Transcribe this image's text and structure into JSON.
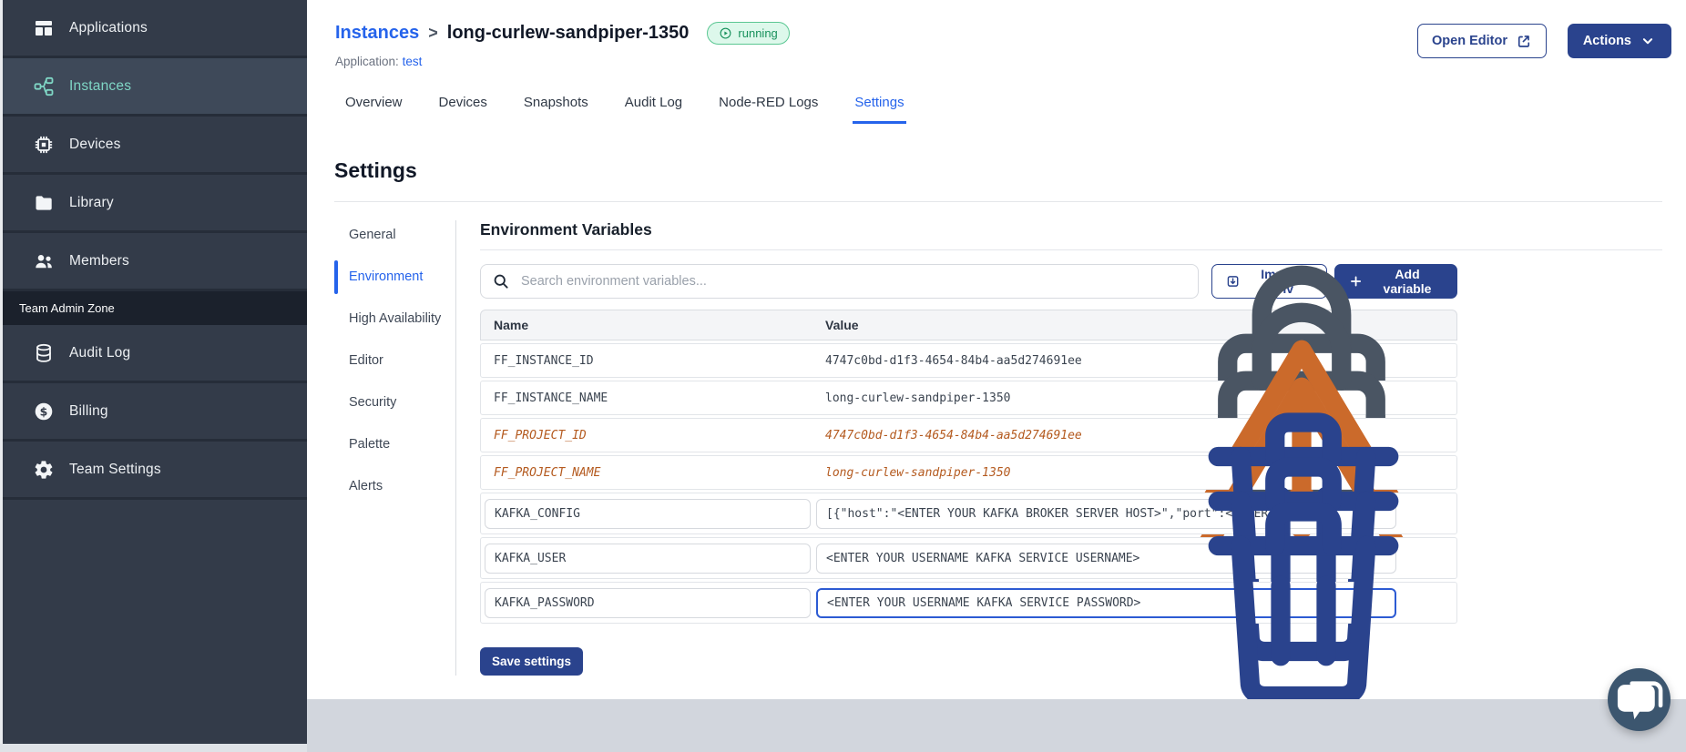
{
  "colors": {
    "accent_blue": "#2563EB",
    "navy_button": "#2A438D",
    "sidebar_bg": "#333B49",
    "sidebar_active_teal": "#7FD6C5",
    "status_green": "#18915C",
    "deprecated_orange": "#B45A1F",
    "bottom_band_gray": "#D2D6DD"
  },
  "sidebar": {
    "items": [
      {
        "label": "Applications",
        "icon": "applications-icon",
        "active": false
      },
      {
        "label": "Instances",
        "icon": "instances-icon",
        "active": true
      },
      {
        "label": "Devices",
        "icon": "devices-icon",
        "active": false
      },
      {
        "label": "Library",
        "icon": "library-icon",
        "active": false
      },
      {
        "label": "Members",
        "icon": "members-icon",
        "active": false
      }
    ],
    "section_label": "Team Admin Zone",
    "admin_items": [
      {
        "label": "Audit Log",
        "icon": "audit-log-icon",
        "active": false
      },
      {
        "label": "Billing",
        "icon": "billing-icon",
        "active": false
      },
      {
        "label": "Team Settings",
        "icon": "team-settings-icon",
        "active": false
      }
    ]
  },
  "header": {
    "breadcrumb_parent": "Instances",
    "breadcrumb_separator": ">",
    "instance_name": "long-curlew-sandpiper-1350",
    "status_badge": "running",
    "application_label": "Application:",
    "application_name": "test",
    "open_editor_label": "Open Editor",
    "actions_label": "Actions"
  },
  "tabs": [
    {
      "label": "Overview",
      "active": false
    },
    {
      "label": "Devices",
      "active": false
    },
    {
      "label": "Snapshots",
      "active": false
    },
    {
      "label": "Audit Log",
      "active": false
    },
    {
      "label": "Node-RED Logs",
      "active": false
    },
    {
      "label": "Settings",
      "active": true
    }
  ],
  "settings": {
    "title": "Settings",
    "nav": [
      {
        "label": "General",
        "active": false
      },
      {
        "label": "Environment",
        "active": true
      },
      {
        "label": "High Availability",
        "active": false
      },
      {
        "label": "Editor",
        "active": false
      },
      {
        "label": "Security",
        "active": false
      },
      {
        "label": "Palette",
        "active": false
      },
      {
        "label": "Alerts",
        "active": false
      }
    ],
    "section_title": "Environment Variables",
    "search_placeholder": "Search environment variables...",
    "import_button": "Import .env",
    "add_button": "Add variable",
    "table": {
      "columns": [
        "Name",
        "Value"
      ],
      "rows": [
        {
          "name": "FF_INSTANCE_ID",
          "value": "4747c0bd-d1f3-4654-84b4-aa5d274691ee",
          "type": "locked",
          "focused": false
        },
        {
          "name": "FF_INSTANCE_NAME",
          "value": "long-curlew-sandpiper-1350",
          "type": "locked",
          "focused": false
        },
        {
          "name": "FF_PROJECT_ID",
          "value": "4747c0bd-d1f3-4654-84b4-aa5d274691ee",
          "type": "deprecated",
          "focused": false
        },
        {
          "name": "FF_PROJECT_NAME",
          "value": "long-curlew-sandpiper-1350",
          "type": "deprecated",
          "focused": false
        },
        {
          "name": "KAFKA_CONFIG",
          "value": "[{\"host\":\"<ENTER YOUR KAFKA BROKER SERVER HOST>\",\"port\":<ENTER PORT>}]",
          "type": "editable",
          "focused": false
        },
        {
          "name": "KAFKA_USER",
          "value": "<ENTER YOUR USERNAME KAFKA SERVICE USERNAME>",
          "type": "editable",
          "focused": false
        },
        {
          "name": "KAFKA_PASSWORD",
          "value": "<ENTER YOUR USERNAME KAFKA SERVICE PASSWORD>",
          "type": "editable",
          "focused": true
        }
      ]
    },
    "save_button": "Save settings"
  }
}
